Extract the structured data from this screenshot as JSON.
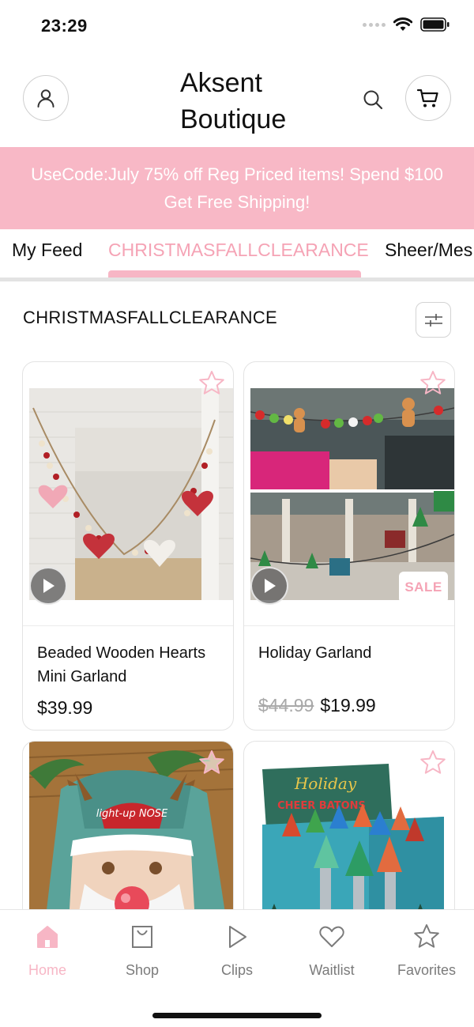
{
  "status_bar": {
    "time": "23:29"
  },
  "header": {
    "brand_line1": "Aksent",
    "brand_line2": "Boutique"
  },
  "promo": {
    "line1": "UseCode:July 75% off Reg Priced items! Spend $100",
    "line2": "Get Free Shipping!"
  },
  "tabs": [
    {
      "label": "My Feed"
    },
    {
      "label": "CHRISTMASFALLCLEARANCE"
    },
    {
      "label": "Sheer/Mes"
    }
  ],
  "section": {
    "title": "CHRISTMASFALLCLEARANCE"
  },
  "products": [
    {
      "name": "Beaded Wooden Hearts Mini Garland",
      "price": "$39.99"
    },
    {
      "name": "Holiday Garland",
      "old_price": "$44.99",
      "price": "$19.99",
      "badge": "SALE"
    },
    {
      "name": "",
      "image_text": "light-up NOSE"
    },
    {
      "name": "",
      "image_text_1": "Holiday",
      "image_text_2": "CHEER BATONS"
    }
  ],
  "nav": [
    {
      "label": "Home",
      "icon": "home-icon",
      "active": true
    },
    {
      "label": "Shop",
      "icon": "shop-bag-icon"
    },
    {
      "label": "Clips",
      "icon": "play-icon"
    },
    {
      "label": "Waitlist",
      "icon": "heart-icon"
    },
    {
      "label": "Favorites",
      "icon": "star-icon"
    }
  ],
  "colors": {
    "accent": "#f7b6c5",
    "promo_bg": "#f8b8c6",
    "inactive": "#7b7b7b"
  }
}
